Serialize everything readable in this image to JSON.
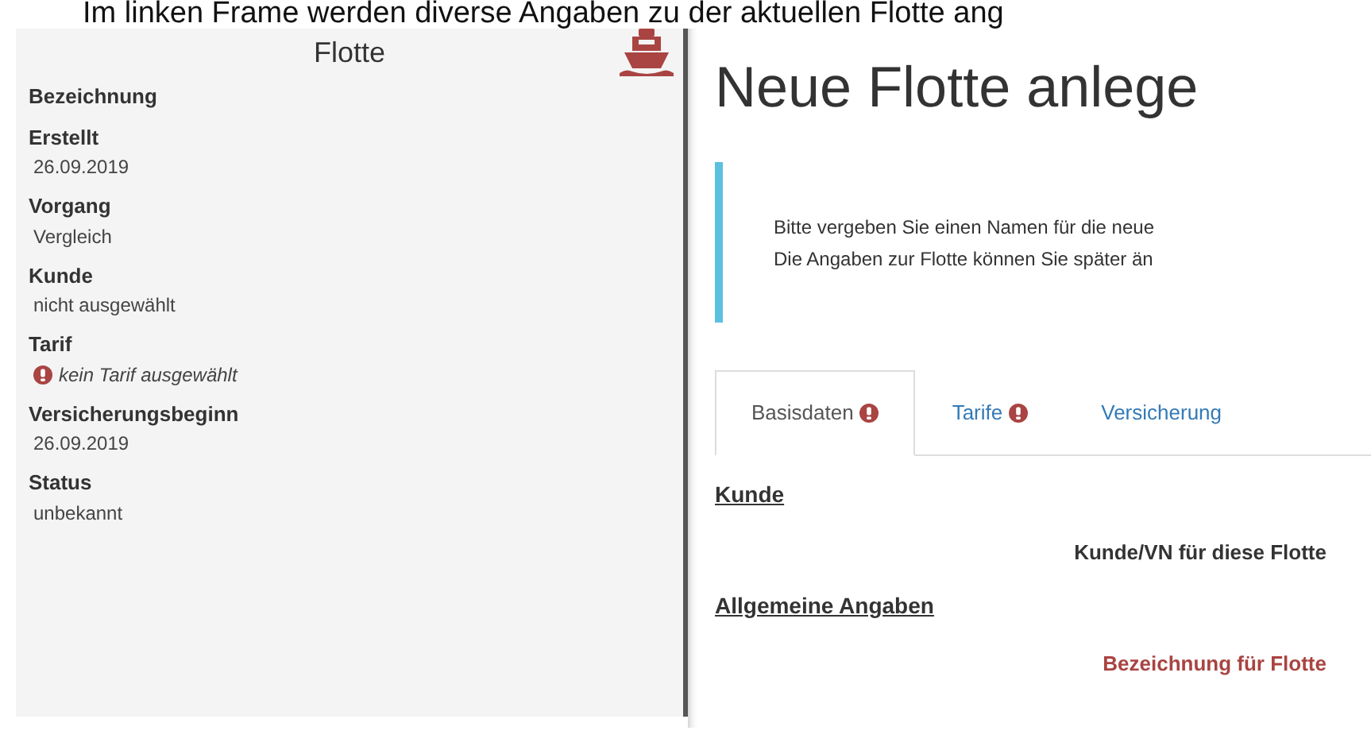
{
  "caption": "Im linken Frame werden diverse Angaben zu der aktuellen Flotte ang",
  "sidebar": {
    "title": "Flotte",
    "fields": [
      {
        "label": "Bezeichnung"
      },
      {
        "label": "Erstellt",
        "value": "26.09.2019",
        "alert": false
      },
      {
        "label": "Vorgang",
        "value": "Vergleich",
        "alert": false
      },
      {
        "label": "Kunde",
        "value": "nicht ausgewählt",
        "alert": false
      },
      {
        "label": "Tarif",
        "value": "kein Tarif ausgewählt",
        "alert": true
      },
      {
        "label": "Versicherungsbeginn",
        "value": "26.09.2019",
        "alert": false
      },
      {
        "label": "Status",
        "value": "unbekannt",
        "alert": false
      }
    ]
  },
  "main": {
    "heading": "Neue Flotte anlege",
    "callout": [
      "Bitte vergeben Sie einen Namen für die neue",
      "Die Angaben zur Flotte können Sie später än"
    ],
    "tabs": [
      {
        "label": "Basisdaten",
        "selected": true,
        "alert": true
      },
      {
        "label": "Tarife",
        "selected": false,
        "alert": true
      },
      {
        "label": "Versicherung",
        "selected": false,
        "alert": false
      }
    ],
    "sections": [
      {
        "title": "Kunde",
        "fields": [
          {
            "label": "Kunde/VN für diese Flotte",
            "invalid": false
          }
        ]
      },
      {
        "title": "Allgemeine Angaben",
        "fields": [
          {
            "label": "Bezeichnung für Flotte",
            "invalid": true
          }
        ]
      }
    ]
  }
}
